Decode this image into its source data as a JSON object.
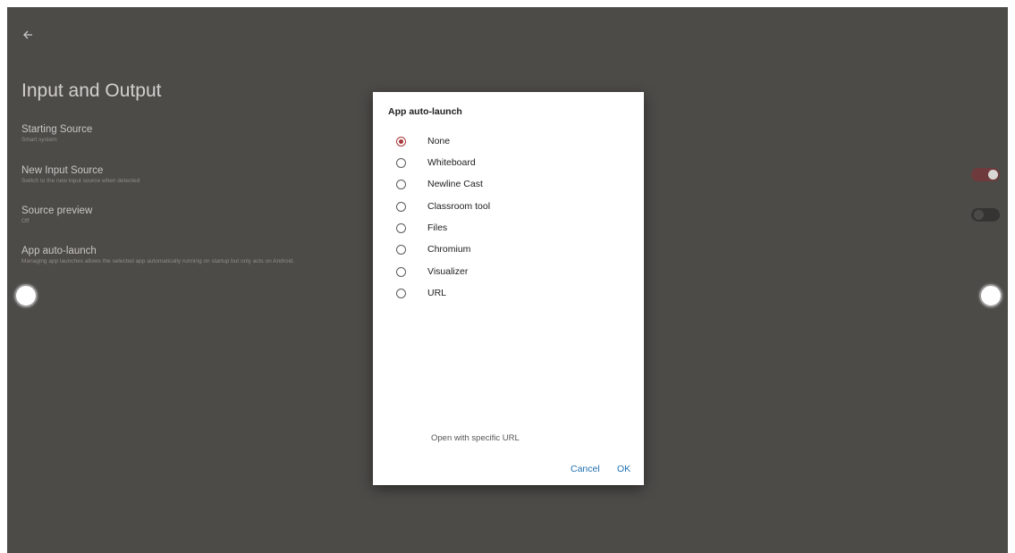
{
  "page": {
    "back_icon": "arrow-left-icon",
    "title": "Input and Output"
  },
  "settings": [
    {
      "title": "Starting Source",
      "subtitle": "Smart system"
    },
    {
      "title": "New Input Source",
      "subtitle": "Switch to the new input source when detected"
    },
    {
      "title": "Source preview",
      "subtitle": "Off"
    },
    {
      "title": "App auto-launch",
      "subtitle": "Managing app launches allows the selected app automatically running on startup but only acts on Android."
    }
  ],
  "toggles": {
    "new_input_source": true,
    "source_preview": false
  },
  "dialog": {
    "title": "App auto-launch",
    "options": [
      "None",
      "Whiteboard",
      "Newline Cast",
      "Classroom tool",
      "Files",
      "Chromium",
      "Visualizer",
      "URL"
    ],
    "selected": "None",
    "url_hint": "Open with specific URL",
    "cancel_label": "Cancel",
    "ok_label": "OK"
  },
  "colors": {
    "background": "#4d4b48",
    "accent": "#a8363b",
    "button": "#1f6fb0"
  }
}
